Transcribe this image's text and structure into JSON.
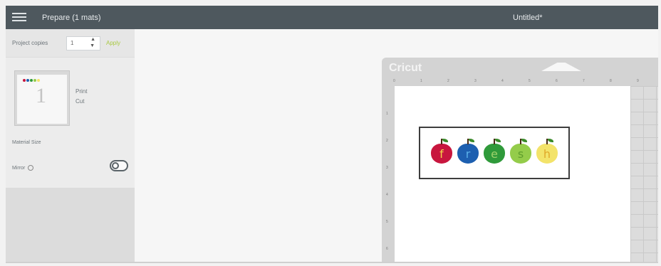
{
  "header": {
    "title": "Prepare (1 mats)",
    "document_name": "Untitled*",
    "menu_icon": "hamburger-menu-icon"
  },
  "sidebar": {
    "project_copies_label": "Project copies",
    "project_copies_value": "1",
    "apply_label": "Apply",
    "mat": {
      "number": "1",
      "print_label": "Print",
      "cut_label": "Cut"
    },
    "material_size_label": "Material Size",
    "mirror_label": "Mirror",
    "mirror_on": false
  },
  "canvas": {
    "mat_brand": "Cricut",
    "ruler_top": [
      "0",
      "1",
      "2",
      "3",
      "4",
      "5",
      "6",
      "7",
      "8",
      "9"
    ],
    "ruler_left": [
      "1",
      "2",
      "3",
      "4",
      "5",
      "6"
    ],
    "design": {
      "apples": [
        {
          "letter": "f",
          "color": "#c8163e",
          "letter_color": "#f2d24a"
        },
        {
          "letter": "r",
          "color": "#1d5fb0",
          "letter_color": "#5ab0e8"
        },
        {
          "letter": "e",
          "color": "#2f9a3a",
          "letter_color": "#9fd26a"
        },
        {
          "letter": "s",
          "color": "#94cc4a",
          "letter_color": "#5f9e2c"
        },
        {
          "letter": "h",
          "color": "#f3e36a",
          "letter_color": "#e0a92a"
        }
      ]
    }
  },
  "colors": {
    "header_bg": "#4e585e",
    "accent_green": "#a9c943"
  }
}
